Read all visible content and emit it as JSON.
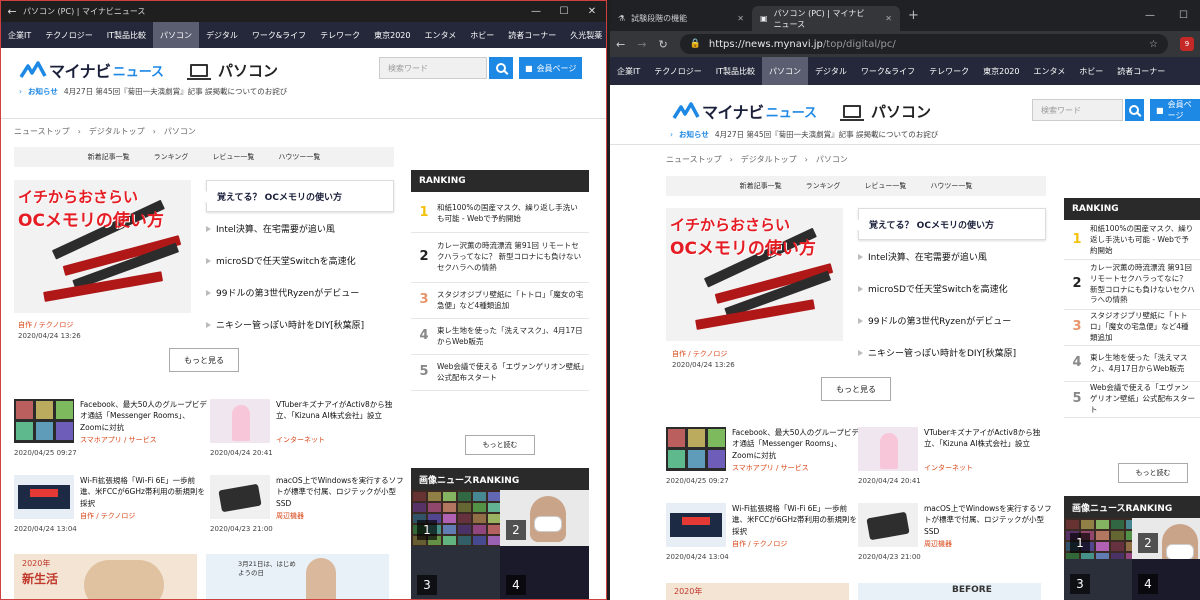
{
  "left_window": {
    "title": "パソコン (PC) | マイナビニュース",
    "nav": [
      "企業IT",
      "テクノロジー",
      "IT製品比較",
      "パソコン",
      "デジタル",
      "ワーク&ライフ",
      "テレワーク",
      "東京2020",
      "エンタメ",
      "ホビー",
      "読者コーナー",
      "久光製薬"
    ]
  },
  "right_window": {
    "tabs": [
      {
        "label": "試験段階の機能"
      },
      {
        "label": "パソコン (PC) | マイナビニュース"
      }
    ],
    "url_host": "https://news.mynavi.jp",
    "url_path": "/top/digital/pc/",
    "ext_badge": "9",
    "nav": [
      "企業IT",
      "テクノロジー",
      "IT製品比較",
      "パソコン",
      "デジタル",
      "ワーク&ライフ",
      "テレワーク",
      "東京2020",
      "エンタメ",
      "ホビー",
      "読者コーナー"
    ]
  },
  "page": {
    "logo_text": "マイナビ",
    "logo_news": "ニュース",
    "section": "パソコン",
    "search_placeholder": "検索ワード",
    "member_label": "会員ページ",
    "notice_label": "お知らせ",
    "notice_text": "4月27日 第45回『菊田一夫演劇賞』記事 誤掲載についてのお詫び",
    "breadcrumb": "ニューストップ　›　デジタルトップ　›　パソコン",
    "subnav": [
      "新着記事一覧",
      "ランキング",
      "レビュー一覧",
      "ハウツー一覧"
    ],
    "hero_text1": "イチからおさらい",
    "hero_text2": "OCメモリの使い方",
    "featured": [
      "覚えてる？ OCメモリの使い方",
      "Intel決算、在宅需要が追い風",
      "microSDで任天堂Switchを高速化",
      "99ドルの第3世代Ryzenがデビュー",
      "ニキシー管っぽい時計をDIY[秋葉原]"
    ],
    "hero_cat": "自作 / テクノロジ",
    "hero_date": "2020/04/24 13:26",
    "more_label": "もっと見る",
    "ranking_title": "RANKING",
    "ranking": [
      {
        "num": "1",
        "color": "#f4c20d",
        "text": "和紙100%の国産マスク、繰り返し手洗いも可能 - Webで予約開始"
      },
      {
        "num": "2",
        "color": "#222222",
        "text": "カレー沢薫の時流漂流 第91回 リモートセクハラってなに？ 新型コロナにも負けないセクハラへの情熱"
      },
      {
        "num": "3",
        "color": "#e8956b",
        "text": "スタジオジブリ壁紙に「トトロ」「魔女の宅急便」など4種類追加"
      },
      {
        "num": "4",
        "color": "#888888",
        "text": "東レ生地を使った「洗えマスク」、4月17日からWeb販売"
      },
      {
        "num": "5",
        "color": "#888888",
        "text": "Web会議で使える「エヴァンゲリオン壁紙」公式配布スタート"
      }
    ],
    "rank_more": "もっと読む",
    "img_ranking_title": "画像ニュースRANKING",
    "img_nums": [
      "1",
      "2",
      "3",
      "4"
    ],
    "articles": [
      {
        "title": "Facebook、最大50人のグループビデオ通話「Messenger Rooms」、Zoomに対抗",
        "cat": "スマホアプリ / サービス",
        "date": "2020/04/25 09:27"
      },
      {
        "title": "VTuberキズナアイがActiv8から独立、「Kizuna AI株式会社」設立",
        "cat": "インターネット",
        "date": "2020/04/24 20:41"
      },
      {
        "title": "Wi-Fi拡張規格「Wi-Fi 6E」一歩前進、米FCCが6GHz帯利用の新規則を採択",
        "cat": "自作 / テクノロジ",
        "date": "2020/04/24 13:04"
      },
      {
        "title": "macOS上でWindowsを実行するソフトが標準で付属、ロジテックが小型SSD",
        "cat": "周辺機器",
        "date": "2020/04/23 21:00"
      }
    ],
    "banner_text1": "2020年",
    "banner_text2": "新生活",
    "banner2_text": "3月21日は、はじめようの日",
    "banner3_text": "BEFORE"
  }
}
